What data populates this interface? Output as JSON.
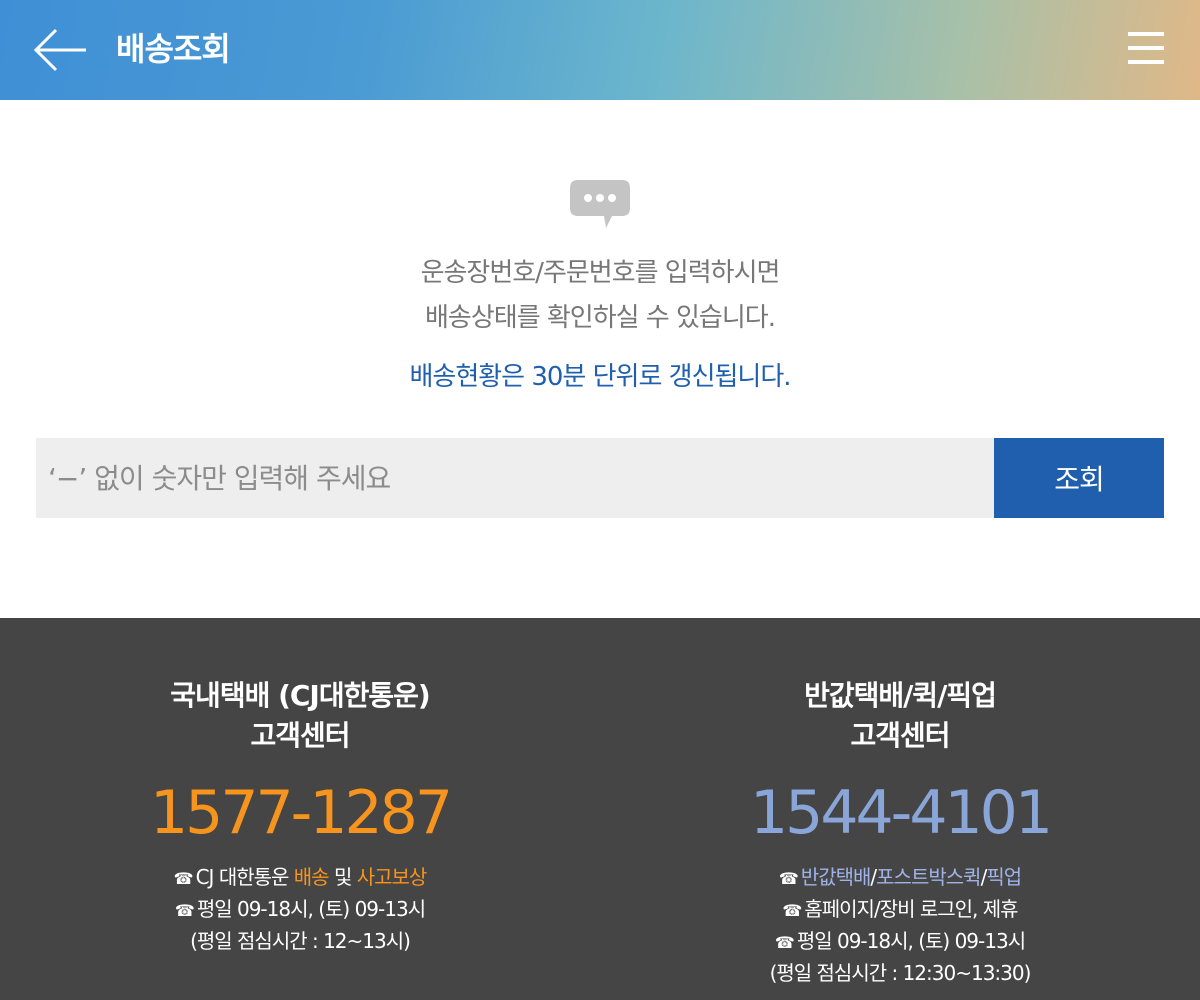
{
  "header": {
    "title": "배송조회",
    "back_icon": "arrow-left-icon",
    "menu_icon": "hamburger-menu-icon",
    "gradient_colors": [
      "#3f8fd6",
      "#6cb6cc",
      "#e0b888"
    ]
  },
  "main": {
    "chat_icon": "chat-bubble-icon",
    "info_line1": "운송장번호/주문번호를 입력하시면",
    "info_line2": "배송상태를 확인하실 수 있습니다.",
    "notice": "배송현황은 30분 단위로 갱신됩니다.",
    "search": {
      "placeholder": "‘−’ 없이 숫자만 입력해 주세요",
      "value": "",
      "button_label": "조회"
    }
  },
  "footer": {
    "left": {
      "title_line1": "국내택배 (CJ대한통운)",
      "title_line2": "고객센터",
      "phone": "1577-1287",
      "tel_glyph": "☎",
      "line1_prefix": "CJ 대한통운 ",
      "line1_link1": "배송",
      "line1_mid": " 및 ",
      "line1_link2": "사고보상",
      "line2": "평일 09-18시, (토) 09-13시",
      "line3": "(평일 점심시간 : 12~13시)"
    },
    "right": {
      "title_line1": "반값택배/퀵/픽업",
      "title_line2": "고객센터",
      "phone": "1544-4101",
      "tel_glyph": "☎",
      "line1_link1": "반값택배",
      "line1_sep1": "/",
      "line1_link2": "포스트박스퀵",
      "line1_sep2": "/",
      "line1_link3": "픽업",
      "line2": "홈페이지/장비 로그인, 제휴",
      "line3": "평일 09-18시, (토) 09-13시",
      "line4": "(평일 점심시간 : 12:30~13:30)"
    }
  },
  "colors": {
    "primary_blue": "#1f5fae",
    "accent_orange": "#f7941d",
    "accent_lightblue": "#8aa6d8",
    "footer_bg": "#454545"
  }
}
